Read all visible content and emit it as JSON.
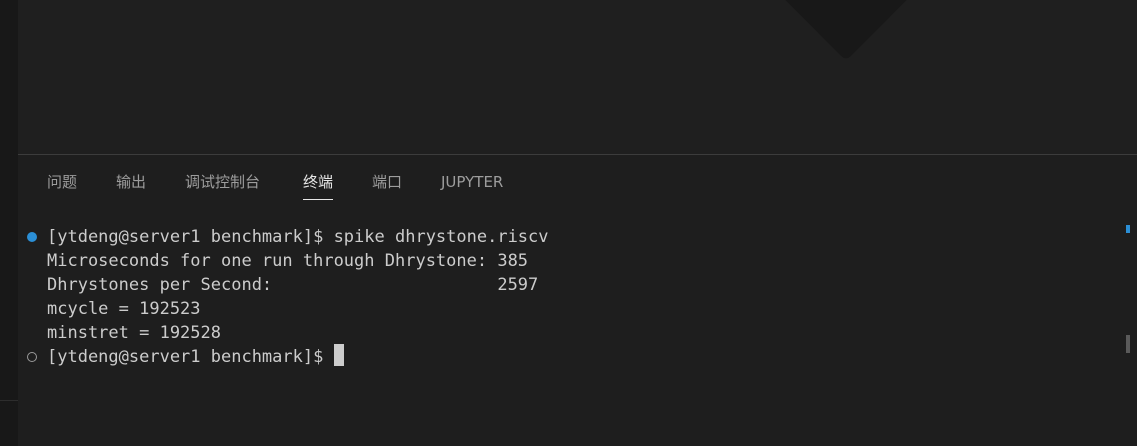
{
  "panel": {
    "tabs": [
      {
        "label": "问题",
        "active": false
      },
      {
        "label": "输出",
        "active": false
      },
      {
        "label": "调试控制台",
        "active": false
      },
      {
        "label": "终端",
        "active": true
      },
      {
        "label": "端口",
        "active": false
      },
      {
        "label": "JUPYTER",
        "active": false
      }
    ]
  },
  "terminal": {
    "lines": [
      {
        "text": "[ytdeng@server1 benchmark]$ spike dhrystone.riscv",
        "decoration": "success"
      },
      {
        "text": "Microseconds for one run through Dhrystone: 385",
        "decoration": "none"
      },
      {
        "text": "Dhrystones per Second:                      2597",
        "decoration": "none"
      },
      {
        "text": "mcycle = 192523",
        "decoration": "none"
      },
      {
        "text": "minstret = 192528",
        "decoration": "none"
      },
      {
        "text": "[ytdeng@server1 benchmark]$ ",
        "decoration": "pending"
      }
    ]
  },
  "colors": {
    "background": "#1e1e1e",
    "text": "#cccccc",
    "accent": "#2b8fd6"
  }
}
